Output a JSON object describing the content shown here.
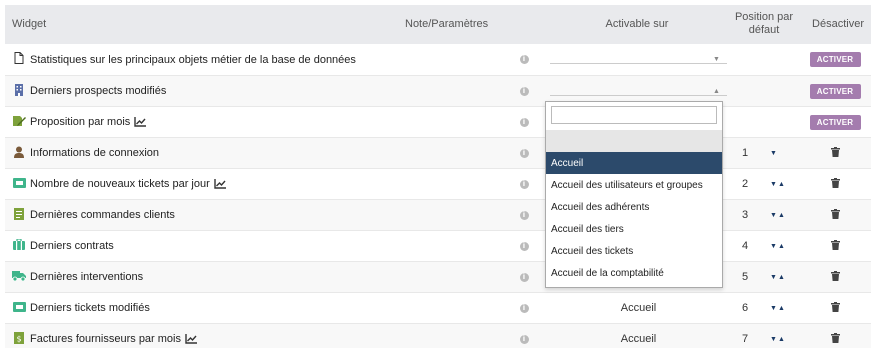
{
  "header": {
    "widget": "Widget",
    "note": "Note/Paramètres",
    "activable": "Activable sur",
    "position": "Position par défaut",
    "desactiver": "Désactiver"
  },
  "rows": [
    {
      "icon": "file-icon",
      "label": "Statistiques sur les principaux objets métier de la base de données",
      "chart": false,
      "activable": "",
      "position": "",
      "action": "ACTIVER"
    },
    {
      "icon": "building-icon",
      "label": "Derniers prospects modifiés",
      "chart": false,
      "activable": "",
      "position": "",
      "action": "ACTIVER"
    },
    {
      "icon": "proposal-icon",
      "label": "Proposition par mois",
      "chart": true,
      "activable": "",
      "position": "",
      "action": "ACTIVER"
    },
    {
      "icon": "user-icon",
      "label": "Informations de connexion",
      "chart": false,
      "activable": "",
      "position": "1",
      "action": "trash"
    },
    {
      "icon": "ticket-icon",
      "label": "Nombre de nouveaux tickets par jour",
      "chart": true,
      "activable": "",
      "position": "2",
      "action": "trash"
    },
    {
      "icon": "order-icon",
      "label": "Dernières commandes clients",
      "chart": false,
      "activable": "",
      "position": "3",
      "action": "trash"
    },
    {
      "icon": "contract-icon",
      "label": "Derniers contrats",
      "chart": false,
      "activable": "",
      "position": "4",
      "action": "trash"
    },
    {
      "icon": "truck-icon",
      "label": "Dernières interventions",
      "chart": false,
      "activable": "",
      "position": "5",
      "action": "trash"
    },
    {
      "icon": "ticket-icon",
      "label": "Derniers tickets modifiés",
      "chart": false,
      "activable": "Accueil",
      "position": "6",
      "action": "trash"
    },
    {
      "icon": "invoice-icon",
      "label": "Factures fournisseurs par mois",
      "chart": true,
      "activable": "Accueil",
      "position": "7",
      "action": "trash"
    }
  ],
  "dropdown": {
    "options": [
      "",
      "Accueil",
      "Accueil des utilisateurs et groupes",
      "Accueil des adhérents",
      "Accueil des tiers",
      "Accueil des tickets",
      "Accueil de la comptabilité"
    ],
    "selected": "Accueil"
  },
  "info_glyph": "i",
  "arrows": {
    "down": "▼",
    "up": "▲"
  },
  "colors": {
    "header_bg": "#e9eaed",
    "activer_btn": "#a47cae",
    "dropdown_selected": "#2c4a6b"
  }
}
